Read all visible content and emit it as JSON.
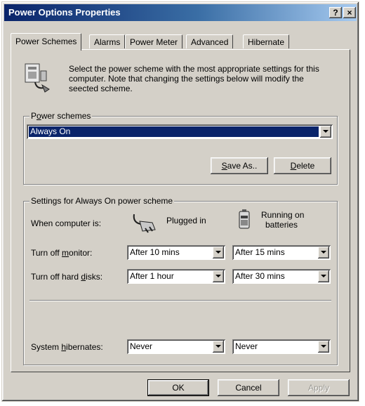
{
  "window": {
    "title": "Power Options Properties",
    "help_label": "?",
    "close_label": "×"
  },
  "tabs": [
    "Power Schemes",
    "Alarms",
    "Power Meter",
    "Advanced",
    "Hibernate"
  ],
  "description": "Select the power scheme with the most appropriate settings for this computer. Note that changing the settings below will modify the seected scheme.",
  "power_schemes": {
    "group_label_pre": "P",
    "group_label_key": "o",
    "group_label_post": "wer schemes",
    "selected": "Always On",
    "save_as_key": "S",
    "save_as_rest": "ave As..",
    "delete_key": "D",
    "delete_rest": "elete"
  },
  "settings": {
    "group_label": "Settings for Always On power scheme",
    "when_label": "When computer is:",
    "plugged_in": "Plugged in",
    "running_on": "Running on",
    "batteries": "batteries",
    "monitor": {
      "pre": "Turn off ",
      "key": "m",
      "post": "onitor:",
      "plugged": "After 10 mins",
      "battery": "After 15 mins"
    },
    "disks": {
      "pre": "Turn off hard ",
      "key": "d",
      "post": "isks:",
      "plugged": "After 1 hour",
      "battery": "After 30 mins"
    },
    "hibernate": {
      "pre": "System ",
      "key": "h",
      "post": "ibernates:",
      "plugged": "Never",
      "battery": "Never"
    }
  },
  "buttons": {
    "ok": "OK",
    "cancel": "Cancel",
    "apply": "Apply"
  },
  "icons": {
    "scheme": "power-scheme-icon",
    "plug": "plug-icon",
    "battery": "battery-icon"
  }
}
